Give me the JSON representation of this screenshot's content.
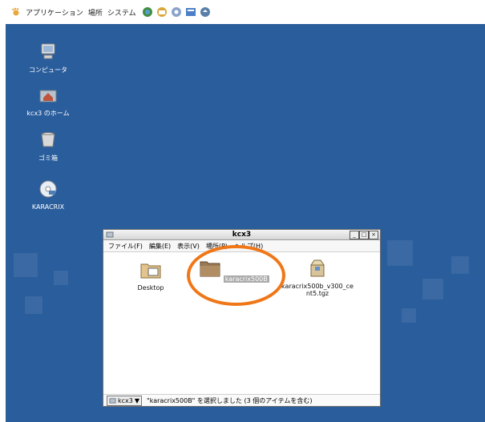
{
  "top_panel": {
    "applications": "アプリケーション",
    "places": "場所",
    "system": "システム"
  },
  "desktop": {
    "icons": [
      {
        "label": "コンピュータ",
        "icon": "computer-icon"
      },
      {
        "label": "kcx3 のホーム",
        "icon": "home-folder-icon"
      },
      {
        "label": "ゴミ箱",
        "icon": "trash-icon"
      },
      {
        "label": "KARACRIX",
        "icon": "cdrom-icon"
      }
    ]
  },
  "window": {
    "title": "kcx3",
    "menus": [
      "ファイル(F)",
      "編集(E)",
      "表示(V)",
      "場所(P)",
      "ヘルプ(H)"
    ],
    "files": [
      {
        "label": "Desktop",
        "icon": "desktop-folder-icon"
      },
      {
        "label": "karacrix500B",
        "icon": "folder-icon",
        "selected": true
      },
      {
        "label": "karacrix500b_v300_cent5.tgz",
        "icon": "archive-icon"
      }
    ],
    "status": {
      "location": "kcx3",
      "message": "\"karacrix500B\" を選択しました (3 個のアイテムを含む)"
    }
  },
  "colors": {
    "desktop_bg": "#2a5d9c",
    "annotation": "#f07718"
  }
}
